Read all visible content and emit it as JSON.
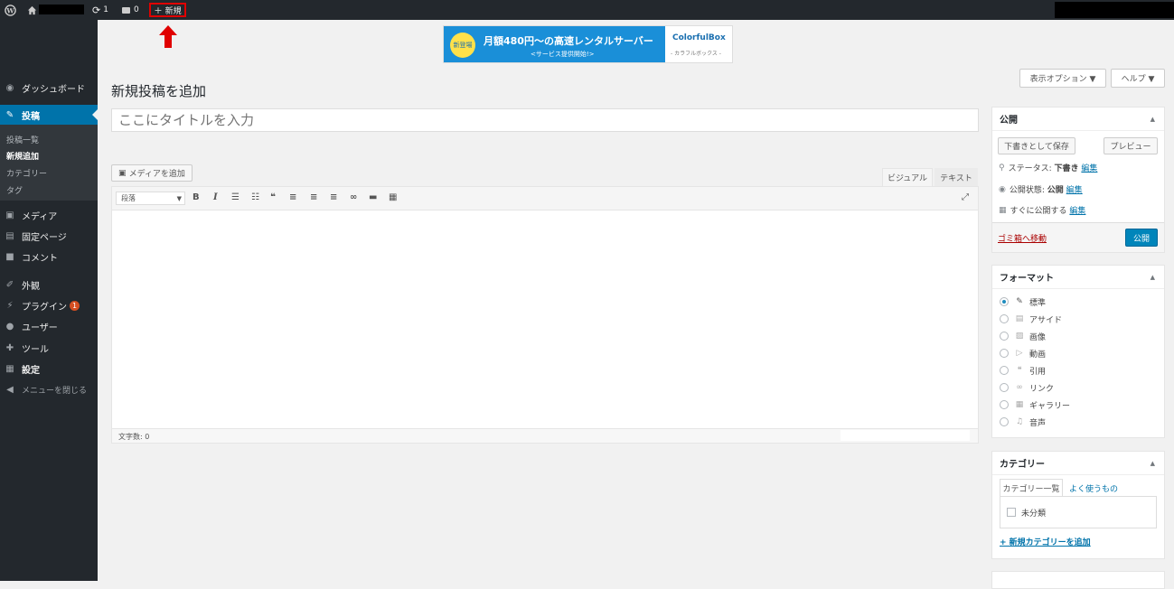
{
  "adminbar": {
    "updates": "1",
    "comments": "0",
    "new_label": "新規"
  },
  "banner": {
    "badge": "新登場",
    "main": "月額480円〜の高速レンタルサーバー",
    "sub": "<サービス提供開始!>",
    "brand": "ColorfulBox",
    "brand_sub": "- カラフルボックス -"
  },
  "sidebar": {
    "dashboard": "ダッシュボード",
    "posts": "投稿",
    "sub_items": [
      "投稿一覧",
      "新規追加",
      "カテゴリー",
      "タグ"
    ],
    "media": "メディア",
    "pages": "固定ページ",
    "comments": "コメント",
    "appearance": "外観",
    "plugins": "プラグイン",
    "plugins_badge": "1",
    "users": "ユーザー",
    "tools": "ツール",
    "settings": "設定",
    "collapse": "メニューを閉じる"
  },
  "screen_options": "表示オプション ▼",
  "help": "ヘルプ ▼",
  "page_title": "新規投稿を追加",
  "title_placeholder": "ここにタイトルを入力",
  "add_media": "メディアを追加",
  "editor_tabs": {
    "visual": "ビジュアル",
    "text": "テキスト"
  },
  "format_select": "段落",
  "word_count": "文字数: 0",
  "publish": {
    "title": "公開",
    "save_draft": "下書きとして保存",
    "preview": "プレビュー",
    "status_label": "ステータス:",
    "status_value": "下書き",
    "visibility_label": "公開状態:",
    "visibility_value": "公開",
    "schedule_label": "すぐに公開する",
    "edit": "編集",
    "trash": "ゴミ箱へ移動",
    "publish_button": "公開"
  },
  "format_box": {
    "title": "フォーマット",
    "options": [
      "標準",
      "アサイド",
      "画像",
      "動画",
      "引用",
      "リンク",
      "ギャラリー",
      "音声"
    ]
  },
  "category_box": {
    "title": "カテゴリー",
    "tab_all": "カテゴリー一覧",
    "tab_popular": "よく使うもの",
    "item": "未分類",
    "add_new": "+ 新規カテゴリーを追加"
  },
  "colors": {
    "accent": "#0073aa",
    "adminbar": "#23282d",
    "highlight": "#e00000"
  }
}
